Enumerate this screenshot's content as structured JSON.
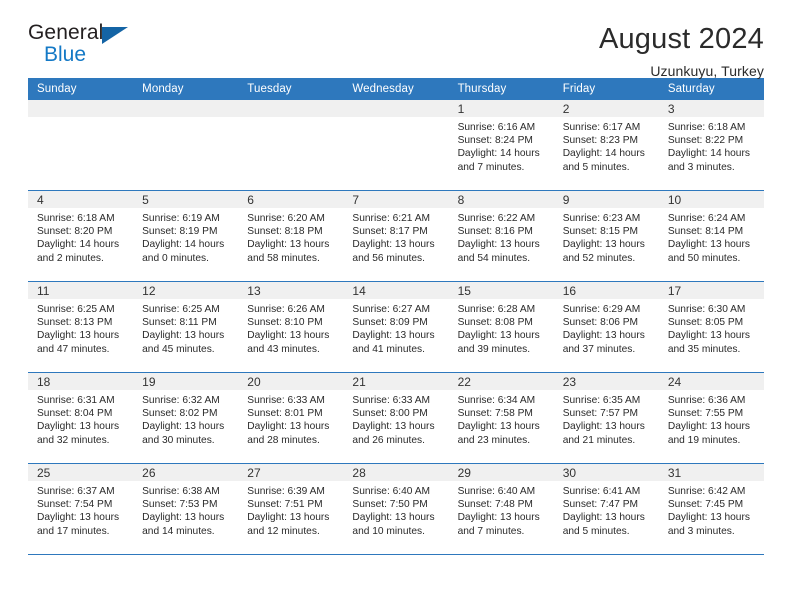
{
  "brand": {
    "name_part1": "General",
    "name_part2": "Blue",
    "triangle_icon": "triangle-icon",
    "accent_color": "#1479c6",
    "logo_dark_color": "#231f20"
  },
  "header": {
    "title": "August 2024",
    "location": "Uzunkuyu, Turkey"
  },
  "theme": {
    "header_bg": "#2e78bd",
    "header_text": "#ffffff",
    "daynum_bg": "#f0f0f0",
    "grid_line": "#2e78bd",
    "body_text": "#2a2a2a"
  },
  "calendar": {
    "weekday_headers": [
      "Sunday",
      "Monday",
      "Tuesday",
      "Wednesday",
      "Thursday",
      "Friday",
      "Saturday"
    ],
    "labels": {
      "sunrise_prefix": "Sunrise:",
      "sunset_prefix": "Sunset:",
      "daylight_prefix": "Daylight:"
    },
    "weeks": [
      [
        {
          "day": "",
          "empty": true
        },
        {
          "day": "",
          "empty": true
        },
        {
          "day": "",
          "empty": true
        },
        {
          "day": "",
          "empty": true
        },
        {
          "day": "1",
          "sunrise": "Sunrise: 6:16 AM",
          "sunset": "Sunset: 8:24 PM",
          "daylight_line1": "Daylight: 14 hours",
          "daylight_line2": "and 7 minutes."
        },
        {
          "day": "2",
          "sunrise": "Sunrise: 6:17 AM",
          "sunset": "Sunset: 8:23 PM",
          "daylight_line1": "Daylight: 14 hours",
          "daylight_line2": "and 5 minutes."
        },
        {
          "day": "3",
          "sunrise": "Sunrise: 6:18 AM",
          "sunset": "Sunset: 8:22 PM",
          "daylight_line1": "Daylight: 14 hours",
          "daylight_line2": "and 3 minutes."
        }
      ],
      [
        {
          "day": "4",
          "sunrise": "Sunrise: 6:18 AM",
          "sunset": "Sunset: 8:20 PM",
          "daylight_line1": "Daylight: 14 hours",
          "daylight_line2": "and 2 minutes."
        },
        {
          "day": "5",
          "sunrise": "Sunrise: 6:19 AM",
          "sunset": "Sunset: 8:19 PM",
          "daylight_line1": "Daylight: 14 hours",
          "daylight_line2": "and 0 minutes."
        },
        {
          "day": "6",
          "sunrise": "Sunrise: 6:20 AM",
          "sunset": "Sunset: 8:18 PM",
          "daylight_line1": "Daylight: 13 hours",
          "daylight_line2": "and 58 minutes."
        },
        {
          "day": "7",
          "sunrise": "Sunrise: 6:21 AM",
          "sunset": "Sunset: 8:17 PM",
          "daylight_line1": "Daylight: 13 hours",
          "daylight_line2": "and 56 minutes."
        },
        {
          "day": "8",
          "sunrise": "Sunrise: 6:22 AM",
          "sunset": "Sunset: 8:16 PM",
          "daylight_line1": "Daylight: 13 hours",
          "daylight_line2": "and 54 minutes."
        },
        {
          "day": "9",
          "sunrise": "Sunrise: 6:23 AM",
          "sunset": "Sunset: 8:15 PM",
          "daylight_line1": "Daylight: 13 hours",
          "daylight_line2": "and 52 minutes."
        },
        {
          "day": "10",
          "sunrise": "Sunrise: 6:24 AM",
          "sunset": "Sunset: 8:14 PM",
          "daylight_line1": "Daylight: 13 hours",
          "daylight_line2": "and 50 minutes."
        }
      ],
      [
        {
          "day": "11",
          "sunrise": "Sunrise: 6:25 AM",
          "sunset": "Sunset: 8:13 PM",
          "daylight_line1": "Daylight: 13 hours",
          "daylight_line2": "and 47 minutes."
        },
        {
          "day": "12",
          "sunrise": "Sunrise: 6:25 AM",
          "sunset": "Sunset: 8:11 PM",
          "daylight_line1": "Daylight: 13 hours",
          "daylight_line2": "and 45 minutes."
        },
        {
          "day": "13",
          "sunrise": "Sunrise: 6:26 AM",
          "sunset": "Sunset: 8:10 PM",
          "daylight_line1": "Daylight: 13 hours",
          "daylight_line2": "and 43 minutes."
        },
        {
          "day": "14",
          "sunrise": "Sunrise: 6:27 AM",
          "sunset": "Sunset: 8:09 PM",
          "daylight_line1": "Daylight: 13 hours",
          "daylight_line2": "and 41 minutes."
        },
        {
          "day": "15",
          "sunrise": "Sunrise: 6:28 AM",
          "sunset": "Sunset: 8:08 PM",
          "daylight_line1": "Daylight: 13 hours",
          "daylight_line2": "and 39 minutes."
        },
        {
          "day": "16",
          "sunrise": "Sunrise: 6:29 AM",
          "sunset": "Sunset: 8:06 PM",
          "daylight_line1": "Daylight: 13 hours",
          "daylight_line2": "and 37 minutes."
        },
        {
          "day": "17",
          "sunrise": "Sunrise: 6:30 AM",
          "sunset": "Sunset: 8:05 PM",
          "daylight_line1": "Daylight: 13 hours",
          "daylight_line2": "and 35 minutes."
        }
      ],
      [
        {
          "day": "18",
          "sunrise": "Sunrise: 6:31 AM",
          "sunset": "Sunset: 8:04 PM",
          "daylight_line1": "Daylight: 13 hours",
          "daylight_line2": "and 32 minutes."
        },
        {
          "day": "19",
          "sunrise": "Sunrise: 6:32 AM",
          "sunset": "Sunset: 8:02 PM",
          "daylight_line1": "Daylight: 13 hours",
          "daylight_line2": "and 30 minutes."
        },
        {
          "day": "20",
          "sunrise": "Sunrise: 6:33 AM",
          "sunset": "Sunset: 8:01 PM",
          "daylight_line1": "Daylight: 13 hours",
          "daylight_line2": "and 28 minutes."
        },
        {
          "day": "21",
          "sunrise": "Sunrise: 6:33 AM",
          "sunset": "Sunset: 8:00 PM",
          "daylight_line1": "Daylight: 13 hours",
          "daylight_line2": "and 26 minutes."
        },
        {
          "day": "22",
          "sunrise": "Sunrise: 6:34 AM",
          "sunset": "Sunset: 7:58 PM",
          "daylight_line1": "Daylight: 13 hours",
          "daylight_line2": "and 23 minutes."
        },
        {
          "day": "23",
          "sunrise": "Sunrise: 6:35 AM",
          "sunset": "Sunset: 7:57 PM",
          "daylight_line1": "Daylight: 13 hours",
          "daylight_line2": "and 21 minutes."
        },
        {
          "day": "24",
          "sunrise": "Sunrise: 6:36 AM",
          "sunset": "Sunset: 7:55 PM",
          "daylight_line1": "Daylight: 13 hours",
          "daylight_line2": "and 19 minutes."
        }
      ],
      [
        {
          "day": "25",
          "sunrise": "Sunrise: 6:37 AM",
          "sunset": "Sunset: 7:54 PM",
          "daylight_line1": "Daylight: 13 hours",
          "daylight_line2": "and 17 minutes."
        },
        {
          "day": "26",
          "sunrise": "Sunrise: 6:38 AM",
          "sunset": "Sunset: 7:53 PM",
          "daylight_line1": "Daylight: 13 hours",
          "daylight_line2": "and 14 minutes."
        },
        {
          "day": "27",
          "sunrise": "Sunrise: 6:39 AM",
          "sunset": "Sunset: 7:51 PM",
          "daylight_line1": "Daylight: 13 hours",
          "daylight_line2": "and 12 minutes."
        },
        {
          "day": "28",
          "sunrise": "Sunrise: 6:40 AM",
          "sunset": "Sunset: 7:50 PM",
          "daylight_line1": "Daylight: 13 hours",
          "daylight_line2": "and 10 minutes."
        },
        {
          "day": "29",
          "sunrise": "Sunrise: 6:40 AM",
          "sunset": "Sunset: 7:48 PM",
          "daylight_line1": "Daylight: 13 hours",
          "daylight_line2": "and 7 minutes."
        },
        {
          "day": "30",
          "sunrise": "Sunrise: 6:41 AM",
          "sunset": "Sunset: 7:47 PM",
          "daylight_line1": "Daylight: 13 hours",
          "daylight_line2": "and 5 minutes."
        },
        {
          "day": "31",
          "sunrise": "Sunrise: 6:42 AM",
          "sunset": "Sunset: 7:45 PM",
          "daylight_line1": "Daylight: 13 hours",
          "daylight_line2": "and 3 minutes."
        }
      ]
    ]
  }
}
